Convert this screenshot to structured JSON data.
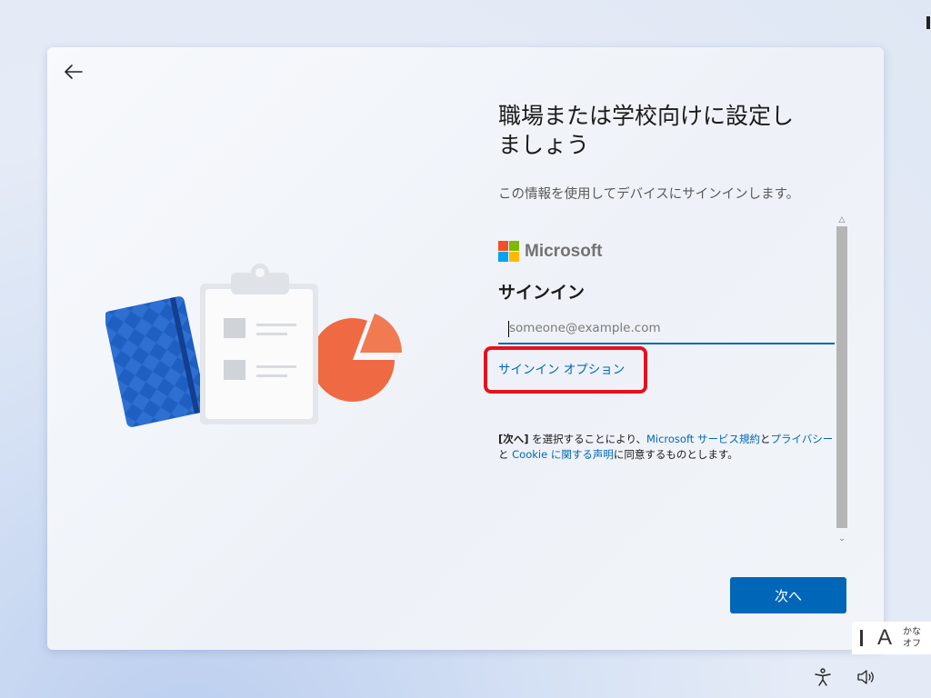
{
  "page": {
    "title_line1": "職場または学校向けに設定し",
    "title_line2": "ましょう",
    "subtitle": "この情報を使用してデバイスにサインインします。"
  },
  "signin": {
    "brand": "Microsoft",
    "heading": "サインイン",
    "email_placeholder": "someone@example.com",
    "email_value": "",
    "options_link": "サインイン オプション"
  },
  "terms": {
    "prefix_bold": "[次へ]",
    "text1": " を選択することにより、",
    "link_services": "Microsoft サービス規約",
    "and": "と",
    "link_privacy_1": "プライバシー",
    "line2_prefix": "と ",
    "link_privacy_2": "Cookie に関する声明",
    "text2": "に同意するものとします。"
  },
  "buttons": {
    "next": "次へ"
  },
  "ime": {
    "mode": "A",
    "kana_line1": "かな",
    "kana_line2": "オフ"
  },
  "icons": {
    "back": "back-arrow-icon",
    "accessibility": "accessibility-icon",
    "volume": "volume-icon"
  },
  "colors": {
    "accent": "#0067b8",
    "highlight": "#e8101e"
  }
}
